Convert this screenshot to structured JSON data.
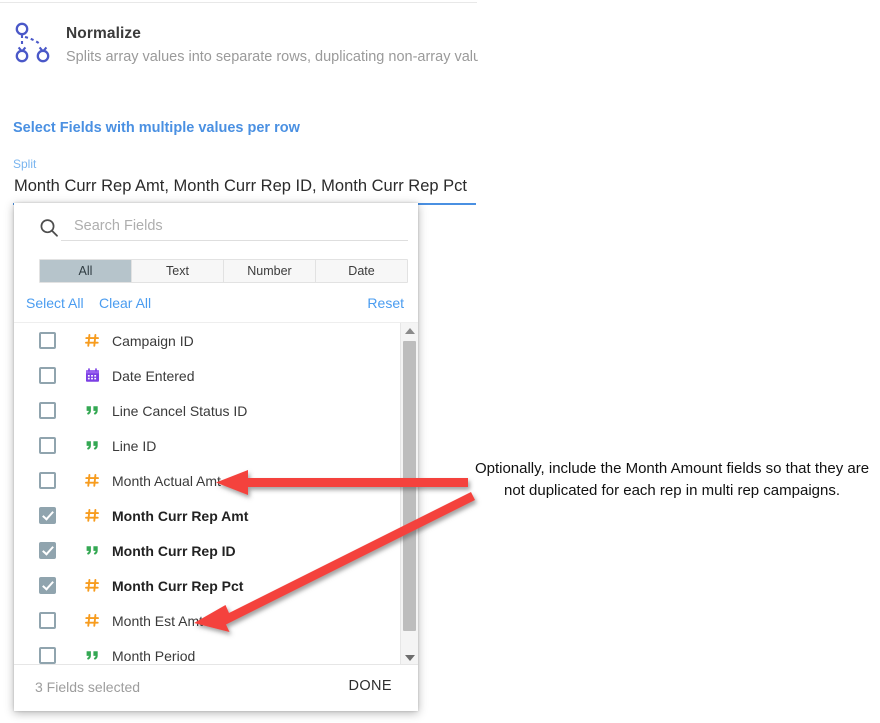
{
  "header": {
    "icon": "normalize-node-icon",
    "title": "Normalize",
    "subtitle": "Splits array values into separate rows, duplicating non-array valu"
  },
  "section": {
    "heading": "Select Fields with multiple values per row"
  },
  "split_field": {
    "label": "Split",
    "value": "Month Curr Rep Amt, Month Curr Rep ID, Month Curr Rep Pct"
  },
  "panel": {
    "search": {
      "icon": "search-icon",
      "placeholder": "Search Fields",
      "value": ""
    },
    "type_tabs": [
      {
        "label": "All",
        "active": true
      },
      {
        "label": "Text",
        "active": false
      },
      {
        "label": "Number",
        "active": false
      },
      {
        "label": "Date",
        "active": false
      }
    ],
    "actions": {
      "select_all": "Select All",
      "clear_all": "Clear All",
      "reset": "Reset"
    },
    "fields": [
      {
        "name": "Campaign ID",
        "type": "number",
        "icon": "number-type-icon",
        "checked": false
      },
      {
        "name": "Date Entered",
        "type": "date",
        "icon": "calendar-type-icon",
        "checked": false
      },
      {
        "name": "Line Cancel Status ID",
        "type": "text",
        "icon": "text-type-icon",
        "checked": false
      },
      {
        "name": "Line ID",
        "type": "text",
        "icon": "text-type-icon",
        "checked": false
      },
      {
        "name": "Month Actual Amt",
        "type": "number",
        "icon": "number-type-icon",
        "checked": false
      },
      {
        "name": "Month Curr Rep Amt",
        "type": "number",
        "icon": "number-type-icon",
        "checked": true
      },
      {
        "name": "Month Curr Rep ID",
        "type": "text",
        "icon": "text-type-icon",
        "checked": true
      },
      {
        "name": "Month Curr Rep Pct",
        "type": "number",
        "icon": "number-type-icon",
        "checked": true
      },
      {
        "name": "Month Est Amt",
        "type": "number",
        "icon": "number-type-icon",
        "checked": false
      },
      {
        "name": "Month Period",
        "type": "text",
        "icon": "text-type-icon",
        "checked": false
      }
    ],
    "scrollbar": {
      "up_icon": "chevron-up-icon",
      "down_icon": "chevron-down-icon"
    },
    "footer": {
      "count_label": "3 Fields selected",
      "done_label": "DONE"
    }
  },
  "annotation": {
    "text": "Optionally, include the Month Amount fields so that they are not duplicated for each rep in multi rep campaigns.",
    "color": "#f4433c",
    "arrows": 2
  },
  "colors": {
    "accent_blue": "#4a90e2",
    "link_blue": "#4a9cf0",
    "tab_active": "#b6c4cb",
    "checkbox": "#90a4ae",
    "type_number": "#f79c1e",
    "type_text": "#34a853",
    "type_date": "#7b3fe4",
    "arrow_red": "#f4433c"
  }
}
